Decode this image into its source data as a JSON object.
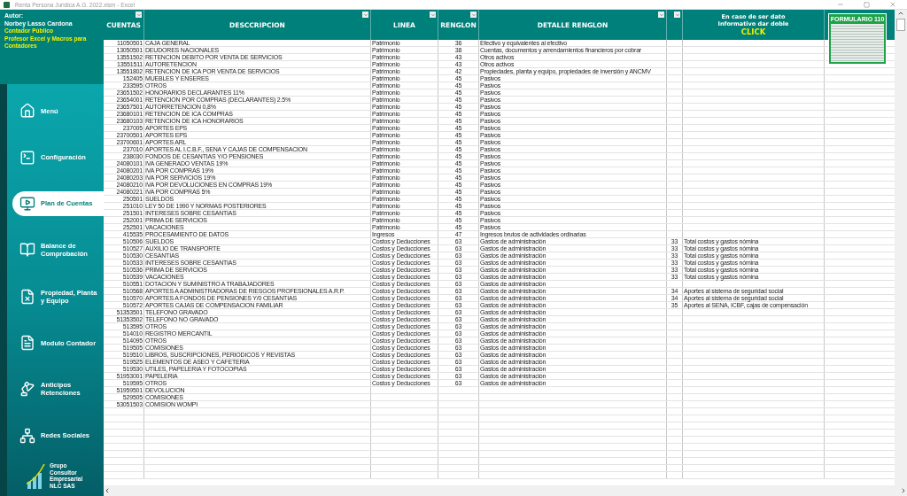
{
  "window": {
    "title": "Renta Persona Juridica A.G. 2022.xlsm - Excel"
  },
  "author": {
    "label": "Autor:",
    "name": "Norbey Lasso Cardona",
    "role": "Contador Público",
    "subtitle": "Profesor Excel y Macros para Contadores"
  },
  "sidebar": {
    "items": [
      {
        "label": "Menú",
        "selected": false
      },
      {
        "label": "Configuración",
        "selected": false
      },
      {
        "label": "Plan de Cuentas",
        "selected": true
      },
      {
        "label": "Balance de Comprobación",
        "selected": false
      },
      {
        "label": "Propiedad, Planta y Equipo",
        "selected": false
      },
      {
        "label": "Modulo Contador",
        "selected": false
      },
      {
        "label": "Anticipos Retenciones",
        "selected": false
      },
      {
        "label": "Redes Sociales",
        "selected": false
      }
    ],
    "logo": "Grupo Consultor Empresarial NLC SAS"
  },
  "table": {
    "columns": [
      "CUENTAS",
      "DESCCRIPCION",
      "LINEA",
      "RENGLON",
      "DETALLE RENGLON"
    ],
    "note_header": {
      "text": "En caso de ser dato Informativo dar doble",
      "highlight": "CLICK"
    },
    "form_thumbnail": "FORMULARIO 110",
    "rows": [
      {
        "account": "11050501",
        "description": "CAJA GENERAL",
        "line": "Patrimonio",
        "renglon": "36",
        "detail": "Efectivo y equivalentes al efectivo"
      },
      {
        "account": "13050501",
        "description": "DEUDORES NACIONALES",
        "line": "Patrimonio",
        "renglon": "38",
        "detail": "Cuentas, documentos y arrendamientos financieros por cobrar"
      },
      {
        "account": "13551502",
        "description": "RETENCION DEBITO POR VENTA DE SERVICIOS",
        "line": "Patrimonio",
        "renglon": "43",
        "detail": "Otros activos"
      },
      {
        "account": "13551511",
        "description": "AUTORETENCION",
        "line": "Patrimonio",
        "renglon": "43",
        "detail": "Otros activos"
      },
      {
        "account": "13551802",
        "description": "RETENCION DE ICA POR VENTA DE SERVICIOS",
        "line": "Patrimonio",
        "renglon": "42",
        "detail": "Propiedades, planta y equipo, propiedades de inversión y ANCMV"
      },
      {
        "account": "152405",
        "description": "MUEBLES Y ENSERES",
        "line": "Patrimonio",
        "renglon": "45",
        "detail": "Pasivos"
      },
      {
        "account": "233595",
        "description": "OTROS",
        "line": "Patrimonio",
        "renglon": "45",
        "detail": "Pasivos"
      },
      {
        "account": "23651502",
        "description": "HONORARIOS DECLARANTES 11%",
        "line": "Patrimonio",
        "renglon": "45",
        "detail": "Pasivos"
      },
      {
        "account": "23654001",
        "description": "RETENCION POR COMPRAS (DECLARANTES) 2.5%",
        "line": "Patrimonio",
        "renglon": "45",
        "detail": "Pasivos"
      },
      {
        "account": "23657501",
        "description": "AUTORRETENCION 0,8%",
        "line": "Patrimonio",
        "renglon": "45",
        "detail": "Pasivos"
      },
      {
        "account": "23680101",
        "description": "RETENCION DE ICA COMPRAS",
        "line": "Patrimonio",
        "renglon": "45",
        "detail": "Pasivos"
      },
      {
        "account": "23680103",
        "description": "RETENCION DE ICA HONORARIOS",
        "line": "Patrimonio",
        "renglon": "45",
        "detail": "Pasivos"
      },
      {
        "account": "237005",
        "description": "APORTES EPS",
        "line": "Patrimonio",
        "renglon": "45",
        "detail": "Pasivos"
      },
      {
        "account": "23700501",
        "description": "APORTES EPS",
        "line": "Patrimonio",
        "renglon": "45",
        "detail": "Pasivos"
      },
      {
        "account": "23700601",
        "description": "APORTES ARL",
        "line": "Patrimonio",
        "renglon": "45",
        "detail": "Pasivos"
      },
      {
        "account": "237010",
        "description": "APORTES AL I.C.B.F., SENA Y CAJAS DE COMPENSACION",
        "line": "Patrimonio",
        "renglon": "45",
        "detail": "Pasivos"
      },
      {
        "account": "238030",
        "description": "FONDOS DE CESANTIAS Y/O PENSIONES",
        "line": "Patrimonio",
        "renglon": "45",
        "detail": "Pasivos"
      },
      {
        "account": "24080101",
        "description": "IVA GENERADO VENTAS 19%",
        "line": "Patrimonio",
        "renglon": "45",
        "detail": "Pasivos"
      },
      {
        "account": "24080201",
        "description": "IVA POR COMPRAS 19%",
        "line": "Patrimonio",
        "renglon": "45",
        "detail": "Pasivos"
      },
      {
        "account": "24080203",
        "description": "IVA POR SERVICIOS 19%",
        "line": "Patrimonio",
        "renglon": "45",
        "detail": "Pasivos"
      },
      {
        "account": "24080210",
        "description": "IVA POR DEVOLUCIONES EN COMPRAS 19%",
        "line": "Patrimonio",
        "renglon": "45",
        "detail": "Pasivos"
      },
      {
        "account": "24080221",
        "description": "IVA POR COMPRAS 5%",
        "line": "Patrimonio",
        "renglon": "45",
        "detail": "Pasivos"
      },
      {
        "account": "250501",
        "description": "SUELDOS",
        "line": "Patrimonio",
        "renglon": "45",
        "detail": "Pasivos"
      },
      {
        "account": "251010",
        "description": "LEY 50 DE 1990 Y NORMAS POSTERIORES",
        "line": "Patrimonio",
        "renglon": "45",
        "detail": "Pasivos"
      },
      {
        "account": "251501",
        "description": "INTERESES SOBRE CESANTIAS",
        "line": "Patrimonio",
        "renglon": "45",
        "detail": "Pasivos"
      },
      {
        "account": "252001",
        "description": "PRIMA DE SERVICIOS",
        "line": "Patrimonio",
        "renglon": "45",
        "detail": "Pasivos"
      },
      {
        "account": "252501",
        "description": "VACACIONES",
        "line": "Patrimonio",
        "renglon": "45",
        "detail": "Pasivos"
      },
      {
        "account": "415535",
        "description": "PROCESAMIENTO DE DATOS",
        "line": "Ingresos",
        "renglon": "47",
        "detail": "Ingresos brutos de actividades ordinarias"
      },
      {
        "account": "510506",
        "description": "SUELDOS",
        "line": "Costos y Deducciones",
        "renglon": "63",
        "detail": "Gastos de administración",
        "code": "33",
        "note": "Total costos y gastos nómina"
      },
      {
        "account": "510527",
        "description": "AUXILIO DE TRANSPORTE",
        "line": "Costos y Deducciones",
        "renglon": "63",
        "detail": "Gastos de administración",
        "code": "33",
        "note": "Total costos y gastos nómina"
      },
      {
        "account": "510530",
        "description": "CESANTIAS",
        "line": "Costos y Deducciones",
        "renglon": "63",
        "detail": "Gastos de administración",
        "code": "33",
        "note": "Total costos y gastos nómina"
      },
      {
        "account": "510533",
        "description": "INTERESES SOBRE CESANTIAS",
        "line": "Costos y Deducciones",
        "renglon": "63",
        "detail": "Gastos de administración",
        "code": "33",
        "note": "Total costos y gastos nómina"
      },
      {
        "account": "510536",
        "description": "PRIMA DE SERVICIOS",
        "line": "Costos y Deducciones",
        "renglon": "63",
        "detail": "Gastos de administración",
        "code": "33",
        "note": "Total costos y gastos nómina"
      },
      {
        "account": "510539",
        "description": "VACACIONES",
        "line": "Costos y Deducciones",
        "renglon": "63",
        "detail": "Gastos de administración",
        "code": "33",
        "note": "Total costos y gastos nómina"
      },
      {
        "account": "510551",
        "description": "DOTACION Y SUMINISTRO A TRABAJADORES",
        "line": "Costos y Deducciones",
        "renglon": "63",
        "detail": "Gastos de administración"
      },
      {
        "account": "510568",
        "description": "APORTES A ADMINISTRADORAS DE RIESGOS PROFESIONALES A.R.P.",
        "line": "Costos y Deducciones",
        "renglon": "63",
        "detail": "Gastos de administración",
        "code": "34",
        "note": "Aportes al sistema de seguridad social"
      },
      {
        "account": "510570",
        "description": "APORTES A FONDOS DE PENSIONES Y/0 CESANTIAS",
        "line": "Costos y Deducciones",
        "renglon": "63",
        "detail": "Gastos de administración",
        "code": "34",
        "note": "Aportes al sistema de seguridad social"
      },
      {
        "account": "510572",
        "description": "APORTES CAJAS DE COMPENSACION FAMILIAR",
        "line": "Costos y Deducciones",
        "renglon": "63",
        "detail": "Gastos de administración",
        "code": "35",
        "note": "Aportes al SENA, ICBF, cajas de compensación"
      },
      {
        "account": "51353501",
        "description": "TELEFONO GRAVADO",
        "line": "Costos y Deducciones",
        "renglon": "63",
        "detail": "Gastos de administración"
      },
      {
        "account": "51353502",
        "description": "TELEFONO NO GRAVADO",
        "line": "Costos y Deducciones",
        "renglon": "63",
        "detail": "Gastos de administración"
      },
      {
        "account": "513595",
        "description": "OTROS",
        "line": "Costos y Deducciones",
        "renglon": "63",
        "detail": "Gastos de administración"
      },
      {
        "account": "514010",
        "description": "REGISTRO MERCANTIL",
        "line": "Costos y Deducciones",
        "renglon": "63",
        "detail": "Gastos de administración"
      },
      {
        "account": "514095",
        "description": "OTROS",
        "line": "Costos y Deducciones",
        "renglon": "63",
        "detail": "Gastos de administración"
      },
      {
        "account": "519505",
        "description": "COMISIONES",
        "line": "Costos y Deducciones",
        "renglon": "63",
        "detail": "Gastos de administración"
      },
      {
        "account": "519510",
        "description": "LIBROS, SUSCRIPCIONES, PERIODICOS Y REVISTAS",
        "line": "Costos y Deducciones",
        "renglon": "63",
        "detail": "Gastos de administración"
      },
      {
        "account": "519525",
        "description": "ELEMENTOS DE ASEO Y CAFETERIA",
        "line": "Costos y Deducciones",
        "renglon": "63",
        "detail": "Gastos de administración"
      },
      {
        "account": "519530",
        "description": "UTILES, PAPELERIA Y FOTOCOPIAS",
        "line": "Costos y Deducciones",
        "renglon": "63",
        "detail": "Gastos de administración"
      },
      {
        "account": "51953001",
        "description": "PAPELERIA",
        "line": "Costos y Deducciones",
        "renglon": "63",
        "detail": "Gastos de administración"
      },
      {
        "account": "519595",
        "description": "OTROS",
        "line": "Costos y Deducciones",
        "renglon": "63",
        "detail": "Gastos de administración"
      },
      {
        "account": "51959501",
        "description": "DEVOLUCION"
      },
      {
        "account": "529505",
        "description": "COMISIONES"
      },
      {
        "account": "53051503",
        "description": "COMISION WOMPI"
      }
    ]
  }
}
